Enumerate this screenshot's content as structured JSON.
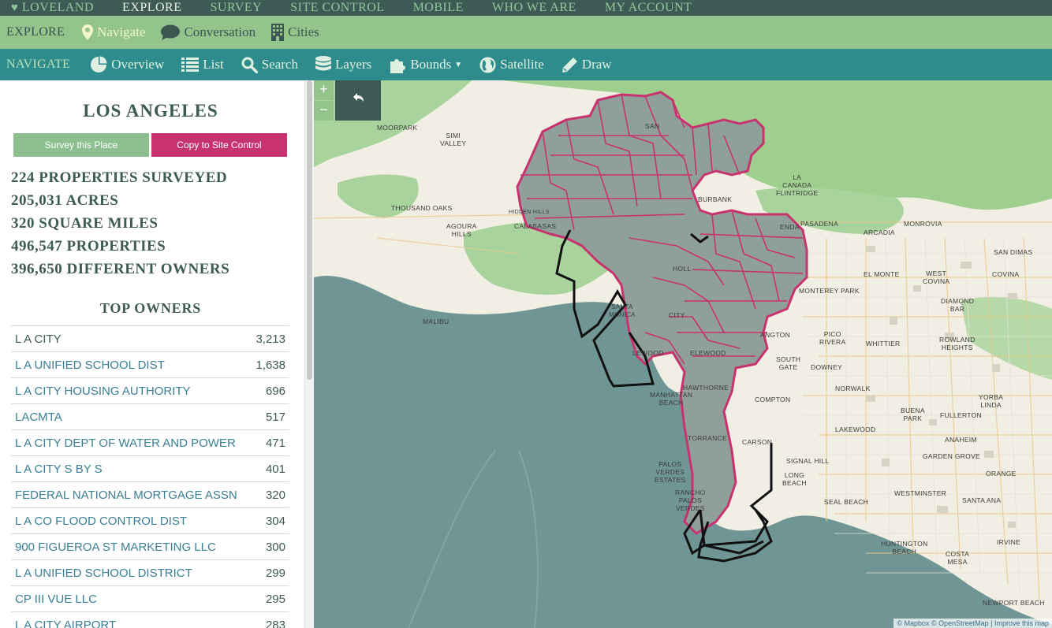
{
  "topnav": {
    "items": [
      {
        "label": "LOVELAND",
        "icon": "heart-icon"
      },
      {
        "label": "EXPLORE"
      },
      {
        "label": "SURVEY"
      },
      {
        "label": "SITE CONTROL"
      },
      {
        "label": "MOBILE"
      },
      {
        "label": "WHO WE ARE"
      },
      {
        "label": "MY ACCOUNT"
      }
    ],
    "active": "EXPLORE"
  },
  "explore_bar": {
    "title": "EXPLORE",
    "items": [
      {
        "label": "Navigate",
        "icon": "map-pin-icon",
        "active": true
      },
      {
        "label": "Conversation",
        "icon": "speech-bubble-icon"
      },
      {
        "label": "Cities",
        "icon": "building-icon"
      }
    ]
  },
  "navigate_bar": {
    "title": "NAVIGATE",
    "items": [
      {
        "label": "Overview",
        "icon": "pie-chart-icon"
      },
      {
        "label": "List",
        "icon": "list-icon"
      },
      {
        "label": "Search",
        "icon": "search-icon"
      },
      {
        "label": "Layers",
        "icon": "layers-icon"
      },
      {
        "label": "Bounds",
        "icon": "puzzle-icon",
        "dropdown": true
      },
      {
        "label": "Satellite",
        "icon": "globe-icon"
      },
      {
        "label": "Draw",
        "icon": "pencil-icon"
      }
    ]
  },
  "sidebar": {
    "place_title": "LOS ANGELES",
    "survey_button": "Survey this Place",
    "copy_button": "Copy to Site Control",
    "stats": [
      "224 PROPERTIES SURVEYED",
      "205,031 ACRES",
      "320 SQUARE MILES",
      "496,547 PROPERTIES",
      "396,650 DIFFERENT OWNERS"
    ],
    "owners_title": "TOP OWNERS",
    "owners": [
      {
        "name": "L A CITY",
        "count": "3,213",
        "linked": false
      },
      {
        "name": "L A UNIFIED SCHOOL DIST",
        "count": "1,638",
        "linked": true
      },
      {
        "name": "L A CITY HOUSING AUTHORITY",
        "count": "696",
        "linked": true
      },
      {
        "name": "LACMTA",
        "count": "517",
        "linked": true
      },
      {
        "name": "L A CITY DEPT OF WATER AND POWER",
        "count": "471",
        "linked": true
      },
      {
        "name": "L A CITY S BY S",
        "count": "401",
        "linked": true
      },
      {
        "name": "FEDERAL NATIONAL MORTGAGE ASSN",
        "count": "320",
        "linked": true
      },
      {
        "name": "L A CO FLOOD CONTROL DIST",
        "count": "304",
        "linked": true
      },
      {
        "name": "900 FIGUEROA ST MARKETING LLC",
        "count": "300",
        "linked": true
      },
      {
        "name": "L A UNIFIED SCHOOL DISTRICT",
        "count": "299",
        "linked": true
      },
      {
        "name": "CP III VUE LLC",
        "count": "295",
        "linked": true
      },
      {
        "name": "L A CITY AIRPORT",
        "count": "283",
        "linked": true
      }
    ]
  },
  "map": {
    "zoom_in": "+",
    "zoom_out": "−",
    "back_icon": "undo-arrow-icon",
    "attribution": "© Mapbox © OpenStreetMap | Improve this map",
    "colors": {
      "ocean": "#6f9695",
      "land": "#f1eee4",
      "park": "#a9d39c",
      "forest": "#9fcf8f",
      "boundary": "#c8336f",
      "city_fill": "#8f9f99",
      "outline": "#111111"
    },
    "labels": [
      "MOORPARK",
      "SIMI\nVALLEY",
      "THOUSAND OAKS",
      "AGOURA\nHILLS",
      "HIDDEN HILLS",
      "CALABASAS",
      "MALIBU",
      "SAN",
      "BURBANK",
      "LA\nCANADA\nFLINTRIDGE",
      "PASADENA",
      "ARCADIA",
      "MONROVIA",
      "SAN DIMAS",
      "EL MONTE",
      "WEST\nCOVINA",
      "COVINA",
      "MONTEREY PARK",
      "DIAMOND\nBAR",
      "SANTA\nMONICA",
      "PICO\nRIVERA",
      "WHITTIER",
      "ROWLAND\nHEIGHTS",
      "SOUTH\nGATE",
      "DOWNEY",
      "HAWTHORNE",
      "MANHATTAN\nBEACH",
      "NORWALK",
      "COMPTON",
      "YORBA\nLINDA",
      "BUENA\nPARK",
      "FULLERTON",
      "LAKEWOOD",
      "TORRANCE",
      "CARSON",
      "ANAHEIM",
      "SIGNAL HILL",
      "PALOS\nVERDES\nESTATES",
      "LONG\nBEACH",
      "GARDEN GROVE",
      "ORANGE",
      "RANCHO\nPALOS\nVERDES",
      "SEAL BEACH",
      "WESTMINSTER",
      "SANTA ANA",
      "HUNTINGTON\nBEACH",
      "COSTA\nMESA",
      "IRVINE",
      "NEWPORT BEACH",
      "ENDA",
      "CITY",
      "HOLL",
      "ELEWOOD",
      "ANGTON",
      "LEWOOD"
    ]
  }
}
